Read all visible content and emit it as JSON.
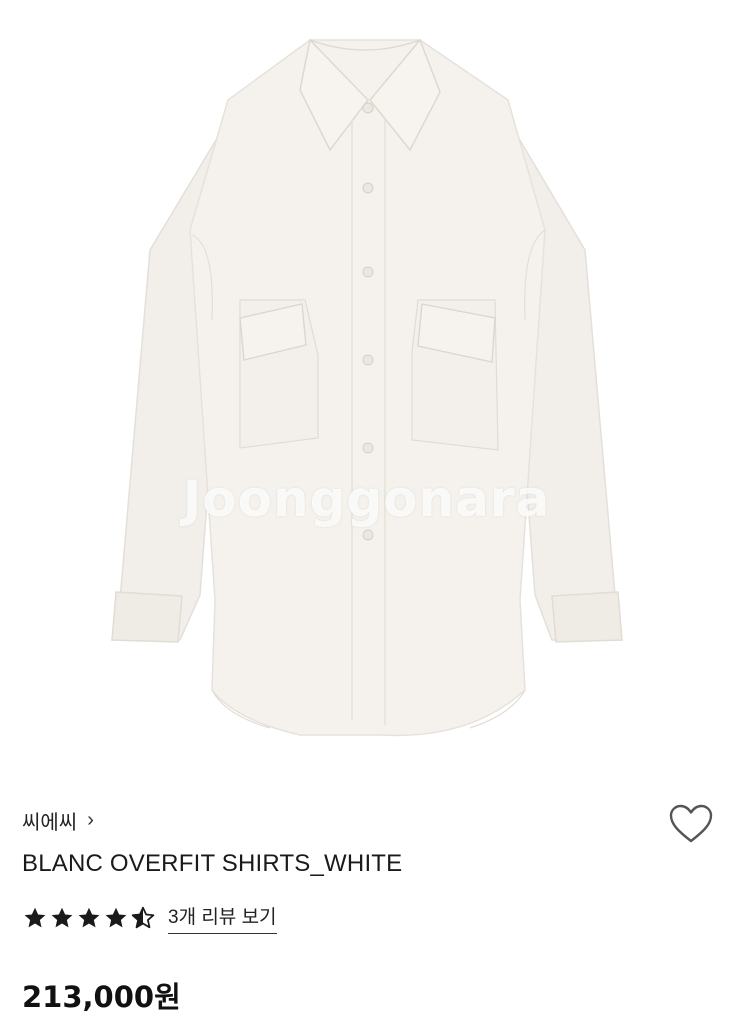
{
  "product": {
    "image_watermark": "Joonggonara",
    "brand": "씨에씨",
    "brand_chevron": "›",
    "title": "BLANC OVERFIT SHIRTS_WHITE",
    "rating": 4.5,
    "rating_max": 5,
    "reviews_label": "3개 리뷰 보기",
    "price": "213,000원"
  },
  "icons": {
    "wishlist": "heart-outline-icon",
    "star": "star-icon"
  },
  "colors": {
    "shirt": "#f4f1ec",
    "star": "#1a1a1a",
    "text": "#1a1a1a"
  }
}
